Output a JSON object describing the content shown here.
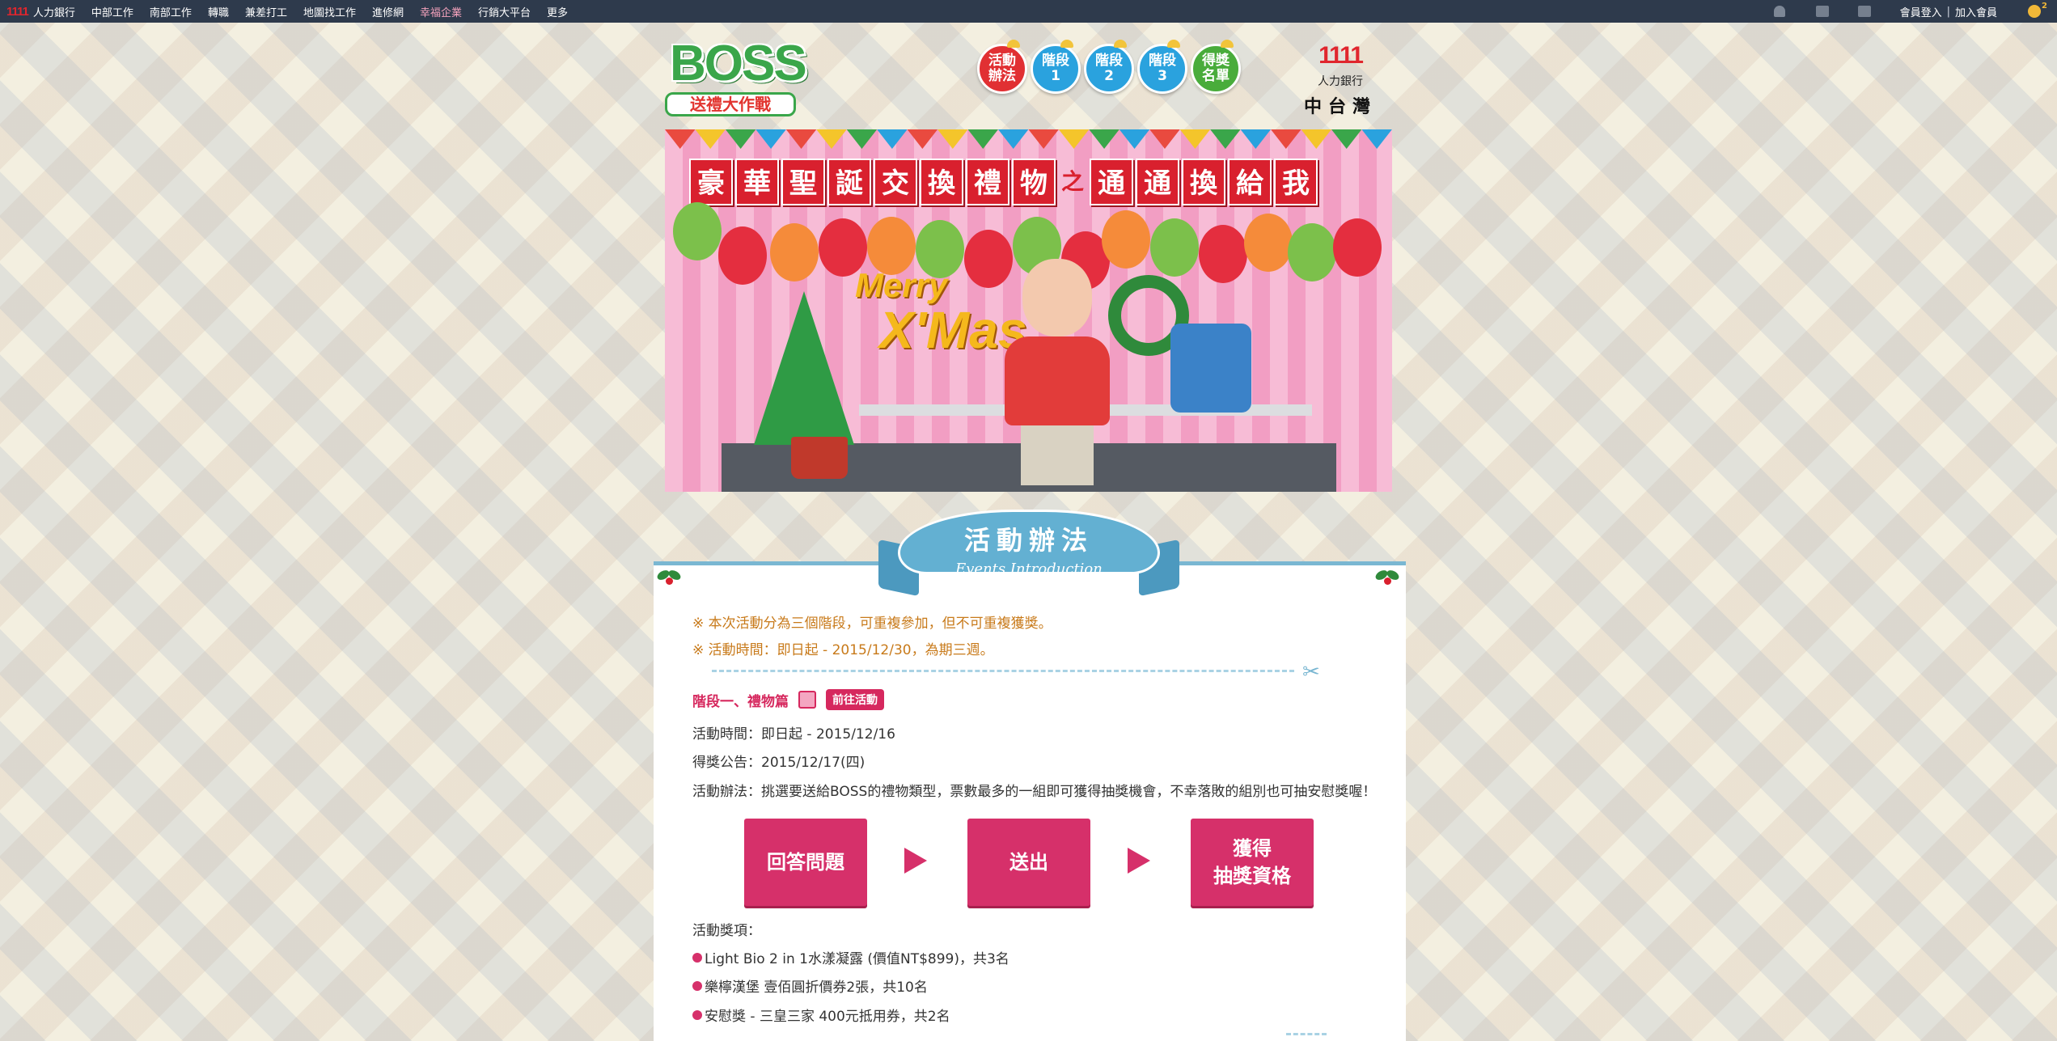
{
  "topbar": {
    "logo": "1111",
    "brand": "人力銀行",
    "nav": [
      "中部工作",
      "南部工作",
      "轉職",
      "兼差打工",
      "地圖找工作",
      "進修網",
      "幸福企業",
      "行銷大平台",
      "更多"
    ],
    "highlight_index": 6,
    "login": "會員登入",
    "separator": "|",
    "join": "加入會員",
    "badge": "2"
  },
  "header": {
    "logo_main": "BOSS",
    "logo_sub": "送禮大作戰",
    "nav_circles": [
      {
        "line1": "活動",
        "line2": "辦法",
        "color": "#e13033"
      },
      {
        "line1": "階段",
        "line2": "1",
        "color": "#2aa2de"
      },
      {
        "line1": "階段",
        "line2": "2",
        "color": "#2aa2de"
      },
      {
        "line1": "階段",
        "line2": "3",
        "color": "#2aa2de"
      },
      {
        "line1": "得獎",
        "line2": "名單",
        "color": "#49ac3b"
      }
    ],
    "brand_num": "1111",
    "brand_bank": "人力銀行",
    "brand_region": "中台灣"
  },
  "banner": {
    "title_chars": [
      "豪",
      "華",
      "聖",
      "誕",
      "交",
      "換",
      "禮",
      "物",
      "之",
      "通",
      "通",
      "換",
      "給",
      "我"
    ],
    "merry": "Merry",
    "xmas": "X'Mas"
  },
  "section": {
    "title_zh": "活動辦法",
    "title_en": "Events Introduction"
  },
  "notes": [
    "※ 本次活動分為三個階段，可重複參加，但不可重複獲獎。",
    "※ 活動時間：即日起 - 2015/12/30，為期三週。"
  ],
  "stage1": {
    "title": "階段一、禮物篇",
    "go_button": "前往活動",
    "time": "活動時間：即日起 - 2015/12/16",
    "announce": "得獎公告：2015/12/17(四)",
    "method": "活動辦法：挑選要送給BOSS的禮物類型，票數最多的一組即可獲得抽獎機會，不幸落敗的組別也可抽安慰獎喔！",
    "steps": [
      "回答問題",
      "送出",
      "獲得\n抽獎資格"
    ],
    "prize_title": "活動獎項：",
    "prizes": [
      "Light Bio 2 in 1水漾凝露 (價值NT$899)，共3名",
      "樂檸漢堡 壹佰圓折價券2張，共10名",
      "安慰獎 - 三皇三家 400元抵用券，共2名"
    ]
  },
  "colors": {
    "accent": "#d6306a",
    "topbar": "#2e3a4c",
    "note": "#c87a1a",
    "ribbon": "#63b0d2"
  }
}
